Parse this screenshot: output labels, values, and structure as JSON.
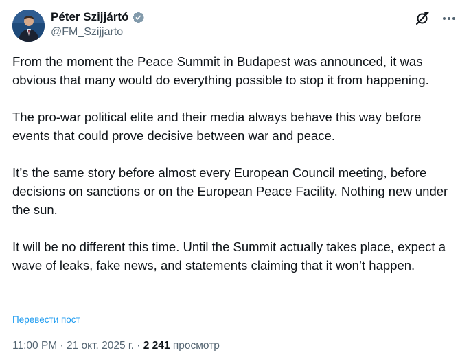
{
  "author": {
    "display_name": "Péter Szijjártó",
    "handle": "@FM_Szijjarto"
  },
  "icons": {
    "verified": "verified-badge-icon",
    "grok": "grok-icon",
    "more": "more-options-icon"
  },
  "colors": {
    "accent": "#1d9bf0",
    "secondary_text": "#536471",
    "primary_text": "#0f1419"
  },
  "tweet": {
    "paragraphs": [
      "From the moment the Peace Summit in Budapest was announced, it was obvious that many would do everything possible to stop it from happening.",
      "The pro-war political elite and their media always behave this way before events that could prove decisive between war and peace.",
      "It’s the same story before almost every European Council meeting, before decisions on sanctions or on the European Peace Facility. Nothing new under the sun.",
      "It will be no different this time. Until the Summit actually takes place, expect a wave of leaks, fake news, and statements claiming that it won’t happen."
    ],
    "translate_label": "Перевести пост"
  },
  "meta": {
    "time": "11:00 PM",
    "separator": " · ",
    "date": "21 окт. 2025 г.",
    "views_count": "2 241",
    "views_label": "просмотр"
  }
}
